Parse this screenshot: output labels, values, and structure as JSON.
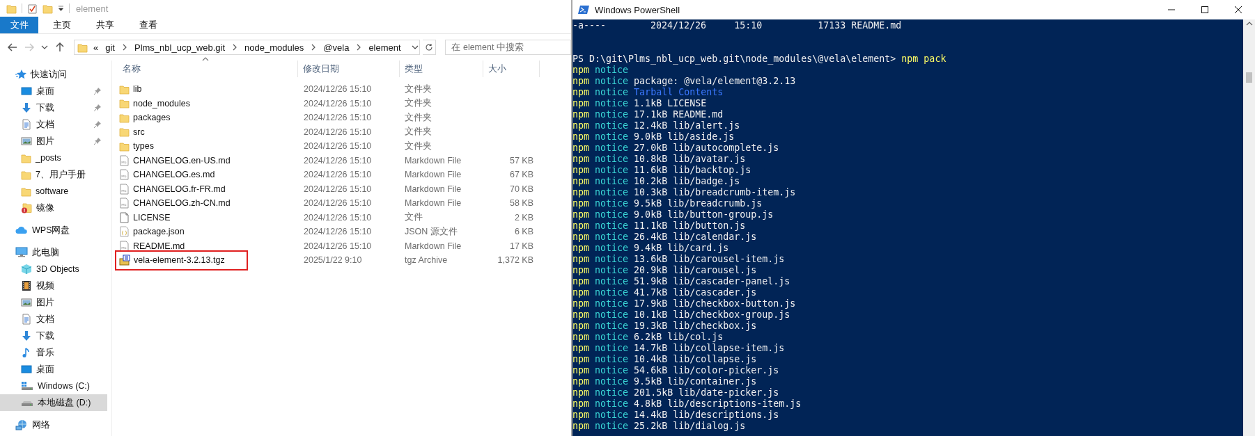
{
  "explorer": {
    "title": "element",
    "ribbon": {
      "file_menu": "文件",
      "tabs": [
        {
          "label": "主页",
          "selected": false
        },
        {
          "label": "共享",
          "selected": false
        },
        {
          "label": "查看",
          "selected": false
        }
      ]
    },
    "navigation": {
      "back_disabled": false,
      "forward_disabled": true
    },
    "address_bar": {
      "overflow": "«",
      "crumbs": [
        "git",
        "Plms_nbl_ucp_web.git",
        "node_modules",
        "@vela",
        "element"
      ]
    },
    "search": {
      "placeholder": "在 element 中搜索"
    },
    "sidebar": {
      "items": [
        {
          "label": "快速访问",
          "kind": "quick-access",
          "selected": false,
          "children": [
            {
              "label": "桌面",
              "kind": "desktop",
              "selected": false,
              "pinned": true
            },
            {
              "label": "下载",
              "kind": "downloads",
              "selected": false,
              "pinned": true
            },
            {
              "label": "文档",
              "kind": "documents",
              "selected": false,
              "pinned": true
            },
            {
              "label": "图片",
              "kind": "pictures",
              "selected": false,
              "pinned": true
            },
            {
              "label": "_posts",
              "kind": "folder",
              "selected": false,
              "pinned": false
            },
            {
              "label": "7、用户手册",
              "kind": "folder",
              "selected": false,
              "pinned": false
            },
            {
              "label": "software",
              "kind": "folder",
              "selected": false,
              "pinned": false
            },
            {
              "label": "镜像",
              "kind": "alert-folder",
              "selected": false,
              "pinned": false
            }
          ]
        },
        {
          "label": "WPS网盘",
          "kind": "cloud",
          "selected": false
        },
        {
          "label": "此电脑",
          "kind": "computer",
          "selected": false,
          "children": [
            {
              "label": "3D Objects",
              "kind": "objects",
              "selected": false
            },
            {
              "label": "视频",
              "kind": "videos",
              "selected": false
            },
            {
              "label": "图片",
              "kind": "pictures",
              "selected": false
            },
            {
              "label": "文档",
              "kind": "documents",
              "selected": false
            },
            {
              "label": "下载",
              "kind": "downloads",
              "selected": false
            },
            {
              "label": "音乐",
              "kind": "music",
              "selected": false
            },
            {
              "label": "桌面",
              "kind": "desktop",
              "selected": false
            },
            {
              "label": "Windows (C:)",
              "kind": "windows-drive",
              "selected": false
            },
            {
              "label": "本地磁盘 (D:)",
              "kind": "drive",
              "selected": true
            }
          ]
        },
        {
          "label": "网络",
          "kind": "network",
          "selected": false
        }
      ]
    },
    "table": {
      "columns": [
        "名称",
        "修改日期",
        "类型",
        "大小"
      ],
      "rows": [
        {
          "name": "lib",
          "modified": "2024/12/26 15:10",
          "type": "文件夹",
          "kind": "folder",
          "marked": false
        },
        {
          "name": "node_modules",
          "modified": "2024/12/26 15:10",
          "type": "文件夹",
          "kind": "folder",
          "marked": false
        },
        {
          "name": "packages",
          "modified": "2024/12/26 15:10",
          "type": "文件夹",
          "kind": "folder",
          "marked": false
        },
        {
          "name": "src",
          "modified": "2024/12/26 15:10",
          "type": "文件夹",
          "kind": "folder",
          "marked": false
        },
        {
          "name": "types",
          "modified": "2024/12/26 15:10",
          "type": "文件夹",
          "kind": "folder",
          "marked": false
        },
        {
          "name": "CHANGELOG.en-US.md",
          "modified": "2024/12/26 15:10",
          "type": "Markdown File",
          "size": "57 KB",
          "kind": "markdown",
          "marked": false
        },
        {
          "name": "CHANGELOG.es.md",
          "modified": "2024/12/26 15:10",
          "type": "Markdown File",
          "size": "67 KB",
          "kind": "markdown",
          "marked": false
        },
        {
          "name": "CHANGELOG.fr-FR.md",
          "modified": "2024/12/26 15:10",
          "type": "Markdown File",
          "size": "70 KB",
          "kind": "markdown",
          "marked": false
        },
        {
          "name": "CHANGELOG.zh-CN.md",
          "modified": "2024/12/26 15:10",
          "type": "Markdown File",
          "size": "58 KB",
          "kind": "markdown",
          "marked": false
        },
        {
          "name": "LICENSE",
          "modified": "2024/12/26 15:10",
          "type": "文件",
          "size": "2 KB",
          "kind": "file",
          "marked": false
        },
        {
          "name": "package.json",
          "modified": "2024/12/26 15:10",
          "type": "JSON 源文件",
          "size": "6 KB",
          "kind": "json",
          "marked": false
        },
        {
          "name": "README.md",
          "modified": "2024/12/26 15:10",
          "type": "Markdown File",
          "size": "17 KB",
          "kind": "markdown",
          "marked": false
        },
        {
          "name": "vela-element-3.2.13.tgz",
          "modified": "2025/1/22 9:10",
          "type": "tgz Archive",
          "size": "1,372 KB",
          "kind": "archive",
          "marked": true
        }
      ]
    }
  },
  "powershell": {
    "title": "Windows PowerShell",
    "lines": [
      {
        "kind": "output",
        "text": "-a----        2024/12/26     15:10          17133 README.md"
      },
      {
        "kind": "blank"
      },
      {
        "kind": "blank"
      },
      {
        "kind": "prompt",
        "prompt": "PS D:\\git\\Plms_nbl_ucp_web.git\\node_modules\\@vela\\element>",
        "command": "npm pack"
      },
      {
        "kind": "npm",
        "prefix": "npm",
        "level": "notice"
      },
      {
        "kind": "npm",
        "prefix": "npm",
        "level": "notice",
        "text": "package: @vela/element@3.2.13"
      },
      {
        "kind": "npm-heading",
        "prefix": "npm",
        "level": "notice",
        "text": "Tarball Contents"
      },
      {
        "kind": "npm",
        "prefix": "npm",
        "level": "notice",
        "text": "1.1kB LICENSE"
      },
      {
        "kind": "npm",
        "prefix": "npm",
        "level": "notice",
        "text": "17.1kB README.md"
      },
      {
        "kind": "npm",
        "prefix": "npm",
        "level": "notice",
        "text": "12.4kB lib/alert.js"
      },
      {
        "kind": "npm",
        "prefix": "npm",
        "level": "notice",
        "text": "9.0kB lib/aside.js"
      },
      {
        "kind": "npm",
        "prefix": "npm",
        "level": "notice",
        "text": "27.0kB lib/autocomplete.js"
      },
      {
        "kind": "npm",
        "prefix": "npm",
        "level": "notice",
        "text": "10.8kB lib/avatar.js"
      },
      {
        "kind": "npm",
        "prefix": "npm",
        "level": "notice",
        "text": "11.6kB lib/backtop.js"
      },
      {
        "kind": "npm",
        "prefix": "npm",
        "level": "notice",
        "text": "10.2kB lib/badge.js"
      },
      {
        "kind": "npm",
        "prefix": "npm",
        "level": "notice",
        "text": "10.3kB lib/breadcrumb-item.js"
      },
      {
        "kind": "npm",
        "prefix": "npm",
        "level": "notice",
        "text": "9.5kB lib/breadcrumb.js"
      },
      {
        "kind": "npm",
        "prefix": "npm",
        "level": "notice",
        "text": "9.0kB lib/button-group.js"
      },
      {
        "kind": "npm",
        "prefix": "npm",
        "level": "notice",
        "text": "11.1kB lib/button.js"
      },
      {
        "kind": "npm",
        "prefix": "npm",
        "level": "notice",
        "text": "26.4kB lib/calendar.js"
      },
      {
        "kind": "npm",
        "prefix": "npm",
        "level": "notice",
        "text": "9.4kB lib/card.js"
      },
      {
        "kind": "npm",
        "prefix": "npm",
        "level": "notice",
        "text": "13.6kB lib/carousel-item.js"
      },
      {
        "kind": "npm",
        "prefix": "npm",
        "level": "notice",
        "text": "20.9kB lib/carousel.js"
      },
      {
        "kind": "npm",
        "prefix": "npm",
        "level": "notice",
        "text": "51.9kB lib/cascader-panel.js"
      },
      {
        "kind": "npm",
        "prefix": "npm",
        "level": "notice",
        "text": "41.7kB lib/cascader.js"
      },
      {
        "kind": "npm",
        "prefix": "npm",
        "level": "notice",
        "text": "17.9kB lib/checkbox-button.js"
      },
      {
        "kind": "npm",
        "prefix": "npm",
        "level": "notice",
        "text": "10.1kB lib/checkbox-group.js"
      },
      {
        "kind": "npm",
        "prefix": "npm",
        "level": "notice",
        "text": "19.3kB lib/checkbox.js"
      },
      {
        "kind": "npm",
        "prefix": "npm",
        "level": "notice",
        "text": "6.2kB lib/col.js"
      },
      {
        "kind": "npm",
        "prefix": "npm",
        "level": "notice",
        "text": "14.7kB lib/collapse-item.js"
      },
      {
        "kind": "npm",
        "prefix": "npm",
        "level": "notice",
        "text": "10.4kB lib/collapse.js"
      },
      {
        "kind": "npm",
        "prefix": "npm",
        "level": "notice",
        "text": "54.6kB lib/color-picker.js"
      },
      {
        "kind": "npm",
        "prefix": "npm",
        "level": "notice",
        "text": "9.5kB lib/container.js"
      },
      {
        "kind": "npm",
        "prefix": "npm",
        "level": "notice",
        "text": "201.5kB lib/date-picker.js"
      },
      {
        "kind": "npm",
        "prefix": "npm",
        "level": "notice",
        "text": "4.8kB lib/descriptions-item.js"
      },
      {
        "kind": "npm",
        "prefix": "npm",
        "level": "notice",
        "text": "14.4kB lib/descriptions.js"
      },
      {
        "kind": "npm",
        "prefix": "npm",
        "level": "notice",
        "text": "25.2kB lib/dialog.js"
      }
    ]
  }
}
